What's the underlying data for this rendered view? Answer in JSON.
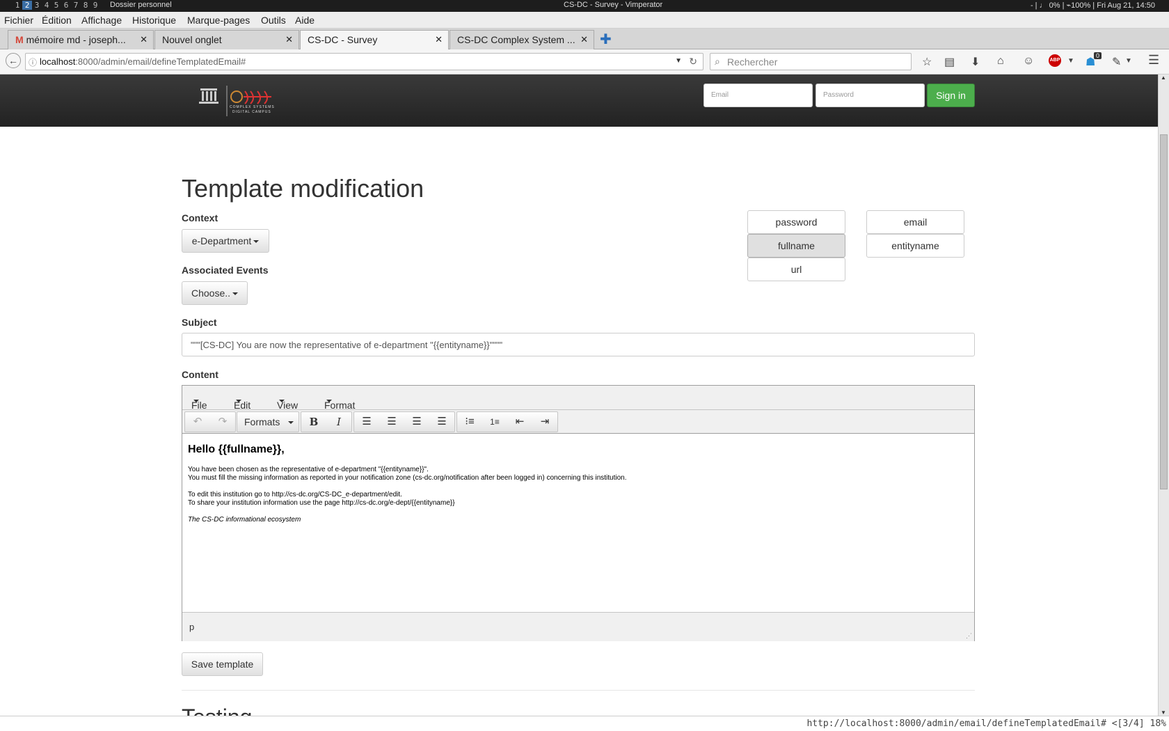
{
  "os_bar": {
    "workspaces": [
      "1",
      "2",
      "3",
      "4",
      "5",
      "6",
      "7",
      "8",
      "9"
    ],
    "active_workspace": "2",
    "folder": "Dossier personnel",
    "window_title": "CS-DC - Survey - Vimperator",
    "status": "- | ♩ 0% | ⌁100% | Fri Aug 21, 14:50"
  },
  "menubar": [
    "Fichier",
    "Édition",
    "Affichage",
    "Historique",
    "Marque-pages",
    "Outils",
    "Aide"
  ],
  "tabs": [
    {
      "label": "mémoire md - joseph...",
      "icon": "gmail-icon"
    },
    {
      "label": "Nouvel onglet"
    },
    {
      "label": "CS-DC - Survey",
      "active": true
    },
    {
      "label": "CS-DC Complex System ..."
    }
  ],
  "navbar": {
    "url_host": "localhost",
    "url_rest": ":8000/admin/email/defineTemplatedEmail#",
    "search_placeholder": "Rechercher",
    "badge_count": "0"
  },
  "header": {
    "logo_text_top": "COMPLEX SYSTEMS",
    "logo_text_bottom": "DIGITAL CAMPUS",
    "email_placeholder": "Email",
    "password_placeholder": "Password",
    "signin_label": "Sign in"
  },
  "page": {
    "title": "Template modification",
    "context_label": "Context",
    "context_value": "e-Department",
    "events_label": "Associated Events",
    "events_value": "Choose..",
    "subject_label": "Subject",
    "subject_value": "\"\"\"[CS-DC] You are now the representative of e-department \"{{entityname}}\"\"\"\"",
    "content_label": "Content",
    "variables": [
      "password",
      "email",
      "fullname",
      "entityname",
      "url"
    ],
    "pressed_variable": "fullname",
    "save_label": "Save template",
    "next_section": "Testing"
  },
  "editor": {
    "menus": [
      "File",
      "Edit",
      "View",
      "Format"
    ],
    "formats_label": "Formats",
    "heading": "Hello {{fullname}},",
    "lines": [
      "You have been chosen as the representative of e-department \"{{entityname}}\".",
      "You must fill the missing information as reported in your notification zone (cs-dc.org/notification after been logged in) concerning this institution.",
      "To edit this institution go to http://cs-dc.org/CS-DC_e-department/edit.",
      "To share your institution information use the page http://cs-dc.org/e-dept/{{entityname}}"
    ],
    "signature": "The CS-DC informational ecosystem",
    "path": "p"
  },
  "vim_status": "http://localhost:8000/admin/email/defineTemplatedEmail# <[3/4] 18%"
}
